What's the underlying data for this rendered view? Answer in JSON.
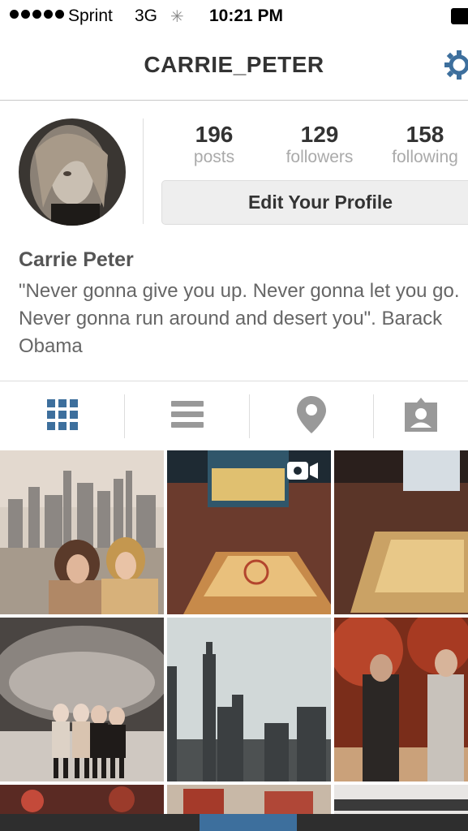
{
  "status_bar": {
    "carrier": "Sprint",
    "network": "3G",
    "time": "10:21 PM"
  },
  "header": {
    "title": "CARRIE_PETER",
    "settings_icon": "gear-icon"
  },
  "profile": {
    "stats": [
      {
        "value": "196",
        "label": "posts"
      },
      {
        "value": "129",
        "label": "followers"
      },
      {
        "value": "158",
        "label": "following"
      }
    ],
    "edit_button": "Edit Your Profile",
    "name": "Carrie Peter",
    "bio": "\"Never gonna give you up. Never gonna let you go. Never gonna run around and desert you\". Barack Obama"
  },
  "view_tabs": [
    {
      "icon": "grid-icon",
      "active": true
    },
    {
      "icon": "list-icon",
      "active": false
    },
    {
      "icon": "location-pin-icon",
      "active": false
    },
    {
      "icon": "tagged-person-icon",
      "active": false
    }
  ],
  "colors": {
    "accent": "#3d6f9d",
    "muted": "#999999"
  }
}
